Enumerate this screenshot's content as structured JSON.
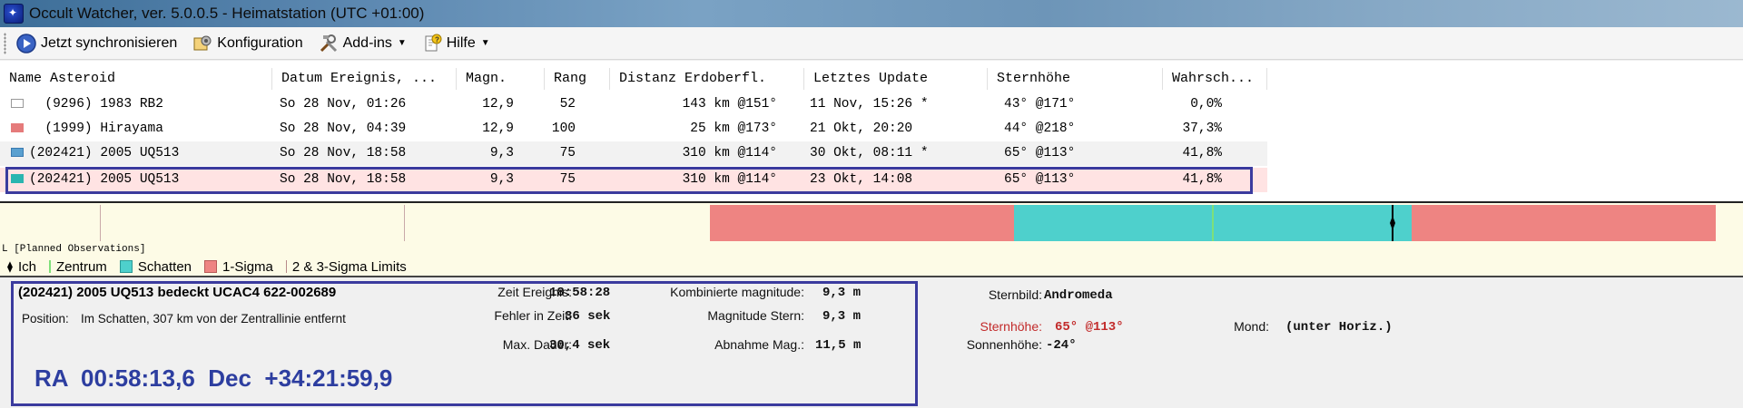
{
  "window": {
    "title": "Occult Watcher, ver. 5.0.0.5 - Heimatstation (UTC +01:00)"
  },
  "toolbar": {
    "sync_label": "Jetzt synchronisieren",
    "config_label": "Konfiguration",
    "addins_label": "Add-ins",
    "help_label": "Hilfe"
  },
  "table": {
    "headers": [
      "Name Asteroid",
      "Datum Ereignis, ...",
      "Magn.",
      "Rang",
      "Distanz Erdoberfl.",
      "Letztes Update",
      "Sternhöhe",
      "Wahrsch..."
    ],
    "rows": [
      {
        "color": "#ffffff",
        "name": "  (9296) 1983 RB2",
        "date": "So 28 Nov, 01:26",
        "mag": "12,9",
        "rank": "52",
        "dist": "143 km @151°",
        "update": "11 Nov, 15:26 *",
        "alt": "43° @171°",
        "prob": "0,0%"
      },
      {
        "color": "#e57b7b",
        "name": "  (1999) Hirayama",
        "date": "So 28 Nov, 04:39",
        "mag": "12,9",
        "rank": "100",
        "dist": "25 km @173°",
        "update": "21 Okt, 20:20",
        "alt": "44° @218°",
        "prob": "37,3%"
      },
      {
        "color": "#5aa0d0",
        "name": "(202421) 2005 UQ513",
        "date": "So 28 Nov, 18:58",
        "mag": "9,3",
        "rank": "75",
        "dist": "310 km @114°",
        "update": "30 Okt, 08:11 *",
        "alt": "65° @113°",
        "prob": "41,8%"
      },
      {
        "color": "#2cb5b0",
        "name": "(202421) 2005 UQ513",
        "date": "So 28 Nov, 18:58",
        "mag": "9,3",
        "rank": "75",
        "dist": "310 km @114°",
        "update": "23 Okt, 14:08",
        "alt": "65° @113°",
        "prob": "41,8%"
      }
    ]
  },
  "timeline": {
    "planned_label": "L [Planned Observations]",
    "colors": {
      "shadow": "#4ed0cc",
      "sigma": "#ee8482",
      "background": "#fdfbe6",
      "center": "#7ee07a"
    }
  },
  "legend": {
    "me": "Ich",
    "center": "Zentrum",
    "shadow": "Schatten",
    "sigma1": "1-Sigma",
    "sigma23": "2 & 3-Sigma Limits"
  },
  "details": {
    "heading": "(202421) 2005 UQ513 bedeckt  UCAC4 622-002689",
    "position_label": "Position:",
    "position_text": "Im Schatten, 307 km von der Zentrallinie entfernt",
    "ra_dec": "RA  00:58:13,6  Dec  +34:21:59,9",
    "event_time_label": "Zeit Ereignis:",
    "event_time": "18:58:28",
    "time_error_label": "Fehler in Zeit:",
    "time_error": "36 sek",
    "max_duration_label": "Max. Dauer:",
    "max_duration": "30,4 sek",
    "combined_mag_label": "Kombinierte magnitude:",
    "combined_mag": "9,3 m",
    "star_mag_label": "Magnitude Stern:",
    "star_mag": "9,3 m",
    "mag_drop_label": "Abnahme Mag.:",
    "mag_drop": "11,5 m",
    "constellation_label": "Sternbild:",
    "constellation": "Andromeda",
    "star_alt_label": "Sternhöhe:",
    "star_alt": "65° @113°",
    "sun_alt_label": "Sonnenhöhe:",
    "sun_alt": "-24°",
    "moon_label": "Mond:",
    "moon": "(unter Horiz.)"
  }
}
